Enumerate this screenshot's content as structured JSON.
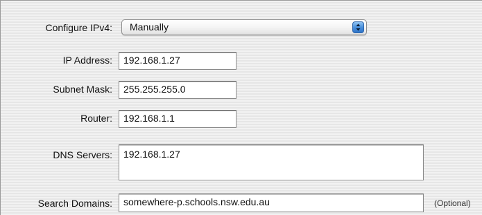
{
  "configure": {
    "label": "Configure IPv4:",
    "selected": "Manually",
    "icon": "popup-arrows-icon"
  },
  "ip_address": {
    "label": "IP Address:",
    "value": "192.168.1.27"
  },
  "subnet_mask": {
    "label": "Subnet Mask:",
    "value": "255.255.255.0"
  },
  "router": {
    "label": "Router:",
    "value": "192.168.1.1"
  },
  "dns_servers": {
    "label": "DNS Servers:",
    "value": "192.168.1.27"
  },
  "search_domains": {
    "label": "Search Domains:",
    "value": "somewhere-p.schools.nsw.edu.au",
    "hint": "(Optional)"
  },
  "colors": {
    "accent": "#4a90dc",
    "panel": "#ececec"
  }
}
